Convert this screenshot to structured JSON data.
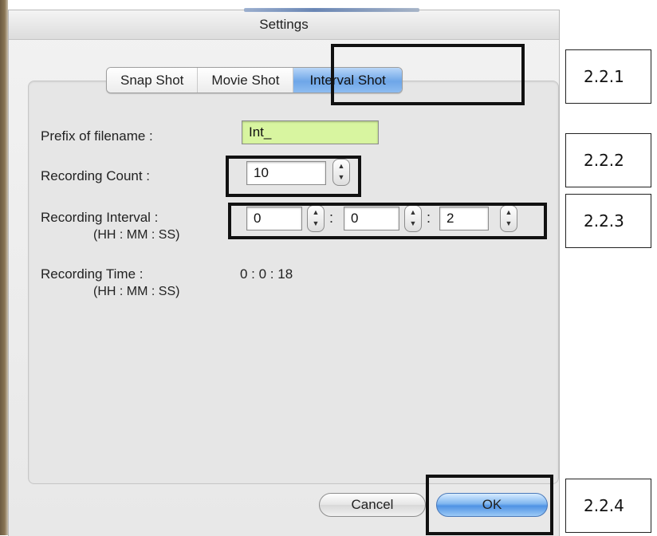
{
  "window": {
    "title": "Settings"
  },
  "tabs": [
    {
      "label": "Snap Shot",
      "active": false
    },
    {
      "label": "Movie Shot",
      "active": false
    },
    {
      "label": "Interval Shot",
      "active": true
    }
  ],
  "form": {
    "prefix_label": "Prefix of filename :",
    "prefix_value": "Int_",
    "count_label": "Recording Count :",
    "count_value": "10",
    "interval_label": "Recording Interval :",
    "interval_sub": "(HH : MM : SS)",
    "interval_hh": "0",
    "interval_mm": "0",
    "interval_ss": "2",
    "time_label": "Recording Time :",
    "time_sub": "(HH : MM : SS)",
    "time_value": "0 : 0 : 18",
    "separator": ":"
  },
  "buttons": {
    "cancel": "Cancel",
    "ok": "OK"
  },
  "callouts": {
    "tabs": "2.2.1",
    "count": "2.2.2",
    "interval": "2.2.3",
    "ok": "2.2.4"
  },
  "colors": {
    "prefix_field_bg": "#d8f5a0",
    "active_tab": "#6ea6e8",
    "ok_button": "#4f92e4"
  }
}
